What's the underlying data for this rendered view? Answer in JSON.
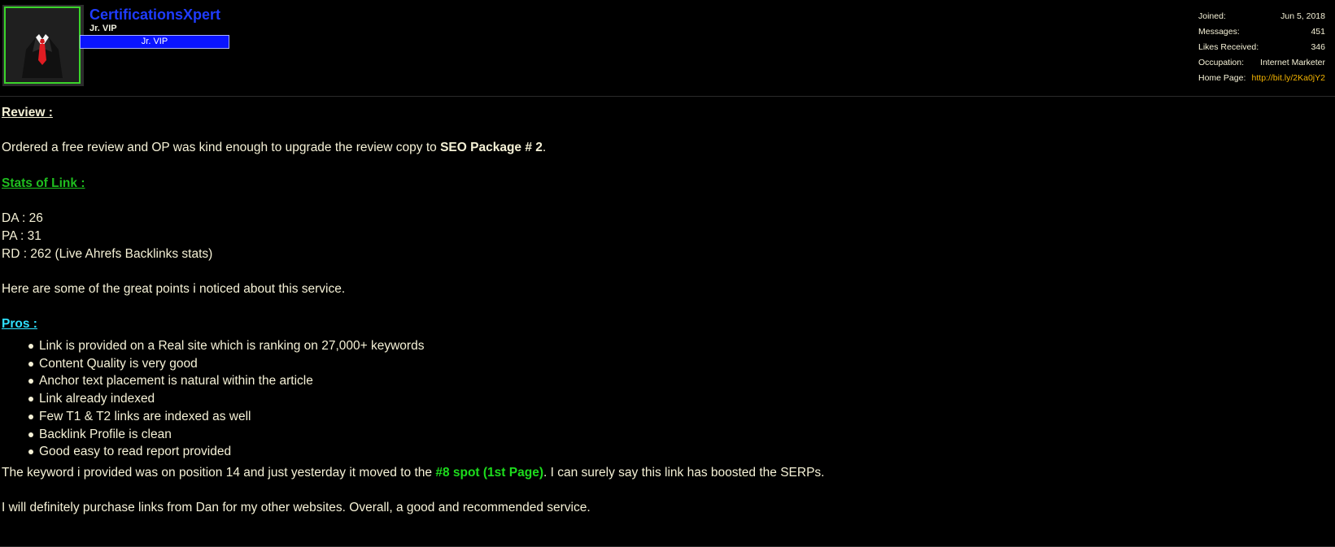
{
  "user": {
    "name": "CertificationsXpert",
    "title": "Jr. VIP",
    "banner": "Jr. VIP",
    "avatar_icon": "suit-tie-avatar-icon"
  },
  "stats": [
    {
      "label": "Joined:",
      "value": "Jun 5, 2018"
    },
    {
      "label": "Messages:",
      "value": "451"
    },
    {
      "label": "Likes Received:",
      "value": "346"
    },
    {
      "label": "Occupation:",
      "value": "Internet Marketer"
    },
    {
      "label": "Home Page:",
      "value": "http://bit.ly/2Ka0jY2"
    }
  ],
  "post": {
    "review_heading": "Review :",
    "intro_text": "Ordered a free review and OP was kind enough to upgrade the review copy to ",
    "intro_bold": "SEO Package # 2",
    "intro_end": ".",
    "stats_heading": "Stats of Link :",
    "da": "DA : 26",
    "pa": "PA : 31",
    "rd": "RD : 262 (Live Ahrefs Backlinks stats)",
    "points_intro": "Here are some of the great points i noticed about this service.",
    "pros_heading": "Pros :",
    "pros": [
      "Link is provided on a Real site which is ranking on 27,000+ keywords",
      "Content Quality is very good",
      "Anchor text placement is natural within the article",
      "Link already indexed",
      "Few T1 & T2 links are indexed as well",
      "Backlink Profile is clean",
      "Good easy to read report provided"
    ],
    "keyword_text": "The keyword i provided was on position 14 and just yesterday it moved to the ",
    "keyword_highlight": "#8 spot (1st Page)",
    "keyword_end": ". I can surely say this link has boosted the SERPs.",
    "closing": "I will definitely purchase links from Dan for my other websites. Overall, a good and recommended service."
  },
  "colors": {
    "background": "#000000",
    "username": "#1f3cff",
    "banner": "#0a14ff",
    "stats_heading": "#1fbf1f",
    "pros_heading": "#2fe0ff",
    "highlight": "#1ddc1d",
    "link": "#f4b400"
  }
}
